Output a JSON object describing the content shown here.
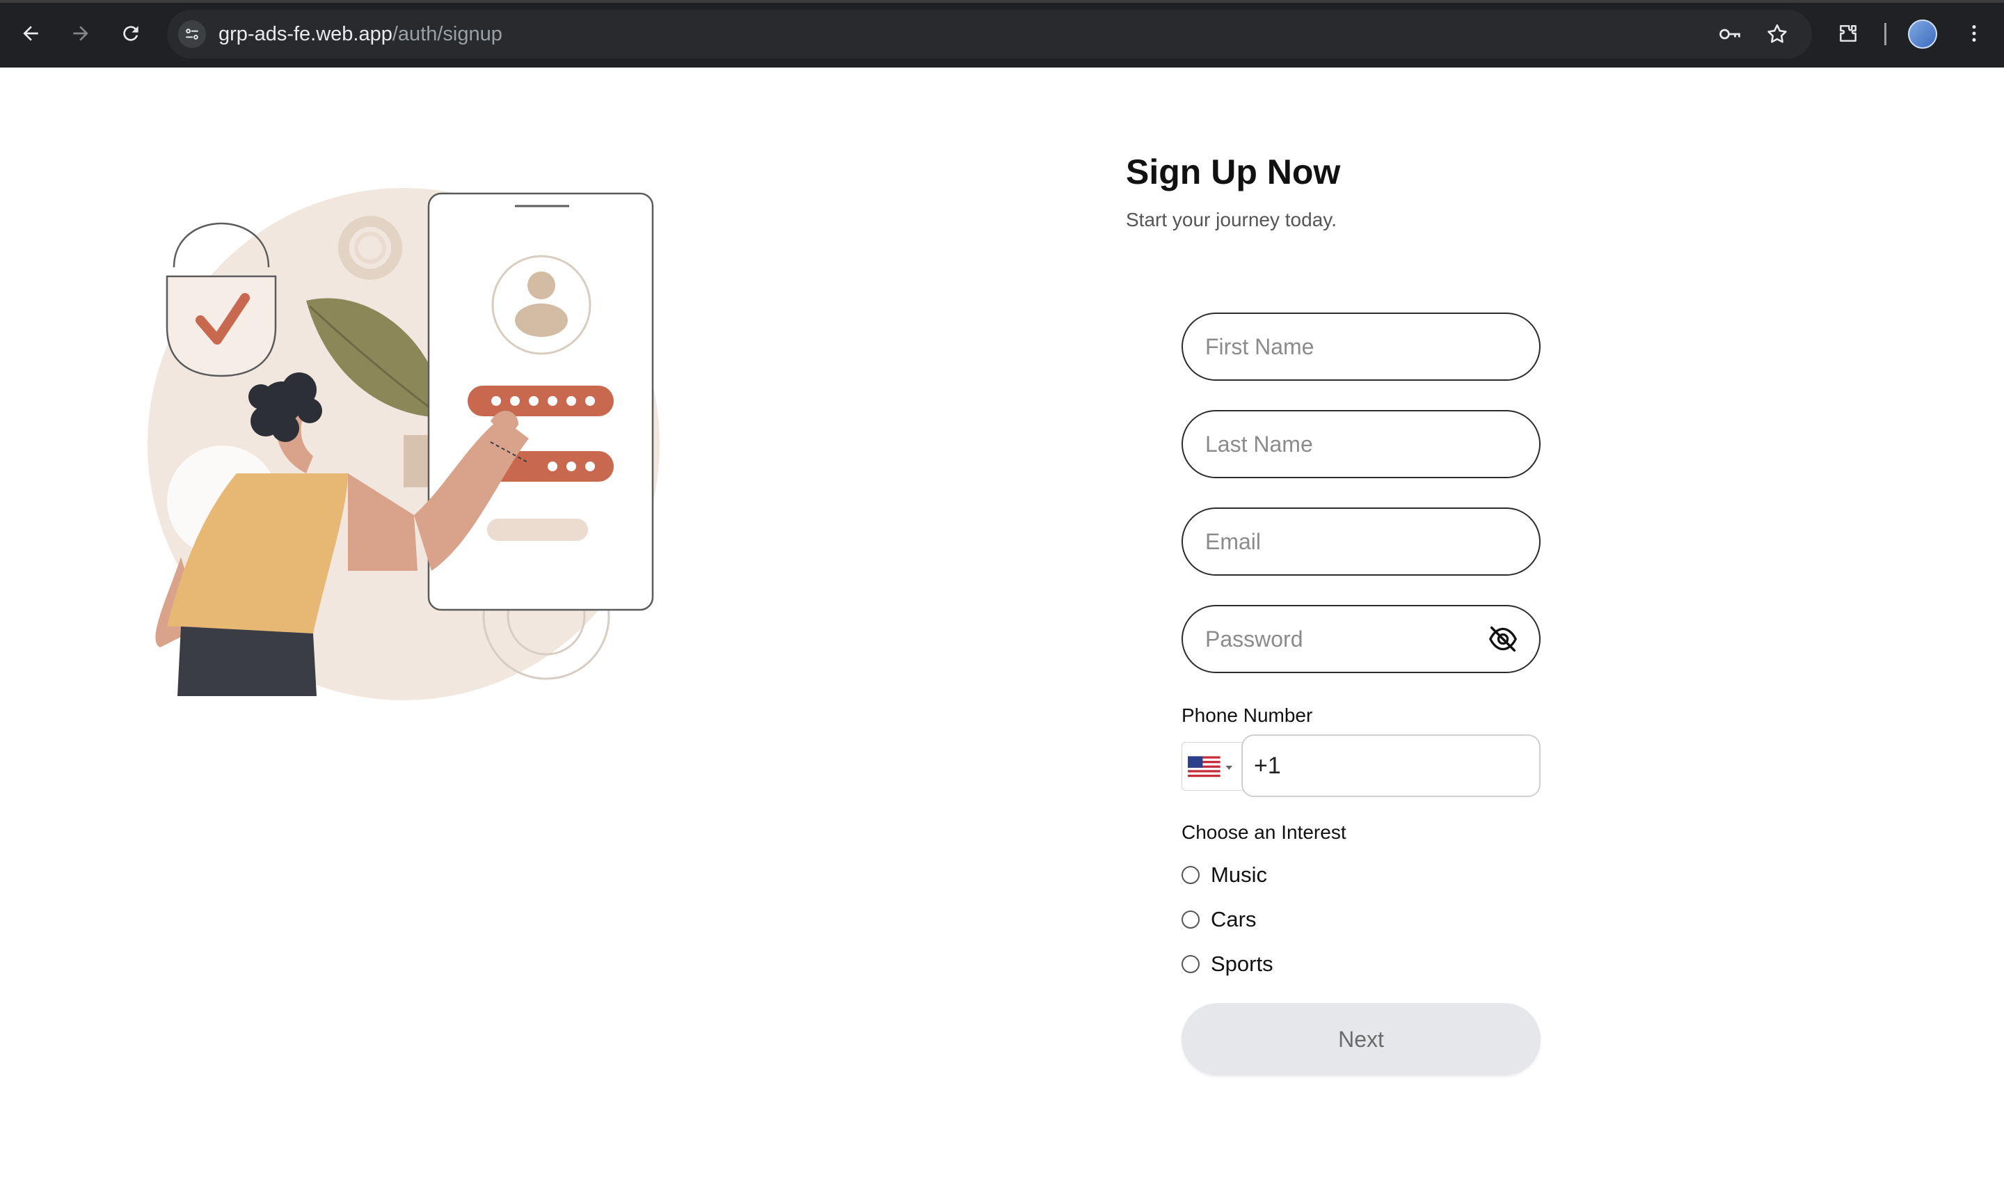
{
  "browser": {
    "url_host": "grp-ads-fe.web.app",
    "url_path": "/auth/signup"
  },
  "signup": {
    "title": "Sign Up Now",
    "subtitle": "Start your journey today.",
    "first_name_placeholder": "First Name",
    "last_name_placeholder": "Last Name",
    "email_placeholder": "Email",
    "password_placeholder": "Password",
    "phone_label": "Phone Number",
    "phone_value": "+1",
    "interest_label": "Choose an Interest",
    "interests": [
      {
        "label": "Music",
        "selected": false
      },
      {
        "label": "Cars",
        "selected": false
      },
      {
        "label": "Sports",
        "selected": false
      }
    ],
    "next_label": "Next"
  },
  "colors": {
    "chrome_bg": "#202124",
    "accent_terracotta": "#c8694f",
    "field_border": "#2b2b2b",
    "button_bg": "#e5e7eb"
  }
}
